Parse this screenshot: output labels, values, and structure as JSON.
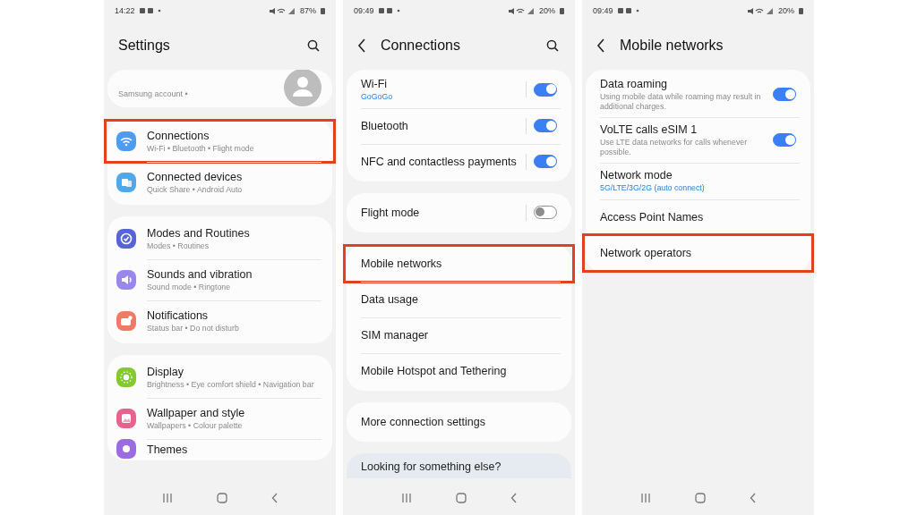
{
  "phones": [
    {
      "status_bar": {
        "time": "14:22",
        "battery": "87%"
      },
      "header": {
        "title": "Settings",
        "search": true
      },
      "groups": [
        {
          "kind": "account",
          "label": "Samsung account •"
        },
        {
          "kind": "list",
          "items": [
            {
              "title": "Connections",
              "subtitle": "Wi-Fi • Bluetooth • Flight mode",
              "kind": "wifi",
              "color": "#4f9bf0",
              "highlighted": true
            },
            {
              "title": "Connected devices",
              "subtitle": "Quick Share • Android Auto",
              "kind": "devices",
              "color": "#4fa8e8",
              "highlighted": false
            }
          ]
        },
        {
          "kind": "list",
          "items": [
            {
              "title": "Modes and Routines",
              "subtitle": "Modes • Routines",
              "kind": "check",
              "color": "#5565d6",
              "highlighted": false
            },
            {
              "title": "Sounds and vibration",
              "subtitle": "Sound mode • Ringtone",
              "kind": "speaker",
              "color": "#9a87ee",
              "highlighted": false
            },
            {
              "title": "Notifications",
              "subtitle": "Status bar • Do not disturb",
              "kind": "bell",
              "color": "#ef7a68",
              "highlighted": false
            }
          ]
        },
        {
          "kind": "list",
          "items": [
            {
              "title": "Display",
              "subtitle": "Brightness • Eye comfort shield • Navigation bar",
              "kind": "sun",
              "color": "#84c92e",
              "highlighted": false
            },
            {
              "title": "Wallpaper and style",
              "subtitle": "Wallpapers • Colour palette",
              "kind": "image",
              "color": "#e5648e",
              "highlighted": false
            },
            {
              "title": "Themes",
              "kind": "brush",
              "color": "#9b6ce0",
              "highlighted": false
            }
          ]
        }
      ]
    },
    {
      "status_bar": {
        "time": "09:49",
        "battery": "20%"
      },
      "header": {
        "title": "Connections",
        "back": true,
        "search": true
      },
      "groups": [
        {
          "kind": "list",
          "items": [
            {
              "title": "Wi-Fi",
              "subtitle": "GoGoGo",
              "accent": true,
              "on": true,
              "divider": true,
              "highlighted": false
            },
            {
              "title": "Bluetooth",
              "on": true,
              "divider": true,
              "highlighted": false
            },
            {
              "title": "NFC and contactless payments",
              "on": true,
              "divider": true,
              "highlighted": false
            }
          ]
        },
        {
          "kind": "list",
          "items": [
            {
              "title": "Flight mode",
              "on": false,
              "divider": true,
              "highlighted": false
            }
          ]
        },
        {
          "kind": "list",
          "items": [
            {
              "title": "Mobile networks",
              "highlighted": true
            },
            {
              "title": "Data usage",
              "highlighted": false
            },
            {
              "title": "SIM manager",
              "highlighted": false
            },
            {
              "title": "Mobile Hotspot and Tethering",
              "highlighted": false
            }
          ]
        },
        {
          "kind": "list",
          "items": [
            {
              "title": "More connection settings",
              "highlighted": false
            }
          ]
        },
        {
          "kind": "suggest",
          "label": "Looking for something else?"
        }
      ]
    },
    {
      "status_bar": {
        "time": "09:49",
        "battery": "20%"
      },
      "header": {
        "title": "Mobile networks",
        "back": true
      },
      "groups": [
        {
          "kind": "list",
          "items": [
            {
              "title": "Data roaming",
              "subtitle": "Using mobile data while roaming may result in additional charges.",
              "on": true,
              "divider": false,
              "highlighted": false
            },
            {
              "title": "VoLTE calls eSIM 1",
              "subtitle": "Use LTE data networks for calls whenever possible.",
              "on": true,
              "divider": false,
              "highlighted": false
            },
            {
              "title": "Network mode",
              "subtitle": "5G/LTE/3G/2G (auto connect)",
              "accent": true,
              "highlighted": false
            },
            {
              "title": "Access Point Names",
              "highlighted": false
            },
            {
              "title": "Network operators",
              "highlighted": true
            }
          ]
        }
      ]
    }
  ]
}
